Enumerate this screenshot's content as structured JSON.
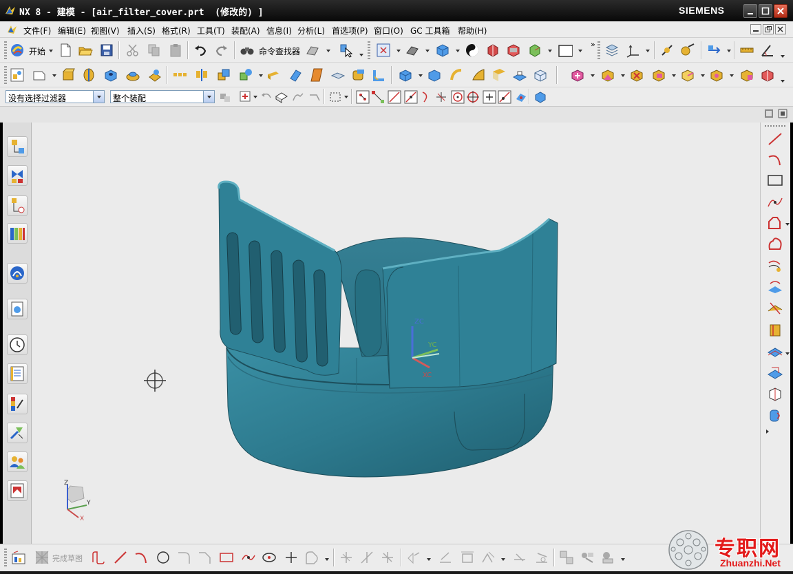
{
  "window": {
    "title": "NX 8 - 建模 - [air_filter_cover.prt  (修改的) ]",
    "brand": "SIEMENS"
  },
  "menu": {
    "items": [
      "文件(F)",
      "编辑(E)",
      "视图(V)",
      "插入(S)",
      "格式(R)",
      "工具(T)",
      "装配(A)",
      "信息(I)",
      "分析(L)",
      "首选项(P)",
      "窗口(O)",
      "GC 工具箱",
      "帮助(H)"
    ]
  },
  "toolbar": {
    "start_label": "开始",
    "command_finder_label": "命令查找器"
  },
  "selection": {
    "filter_value": "没有选择过滤器",
    "scope_value": "整个装配"
  },
  "sketch": {
    "finish_label": "完成草图"
  },
  "csys": {
    "zc": "ZC",
    "yc": "YC",
    "xc": "XC",
    "z": "Z",
    "y": "Y",
    "x": "X"
  },
  "watermark": {
    "cn": "专职网",
    "en": "Zhuanzhi.Net"
  },
  "colors": {
    "part": "#2f7d92",
    "part_dark": "#1f5f70",
    "viewport_bg": "#ebebeb",
    "accent_red": "#e31b1b"
  }
}
